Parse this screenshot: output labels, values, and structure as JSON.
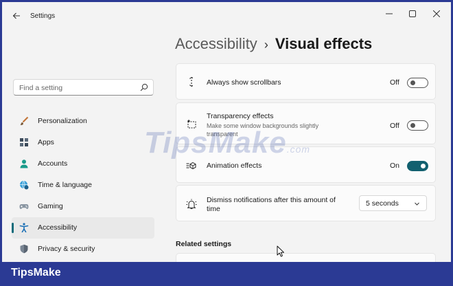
{
  "window": {
    "app_title": "Settings",
    "back_icon": "arrow-left-icon",
    "controls": [
      "minimize-icon",
      "maximize-icon",
      "close-icon"
    ]
  },
  "sidebar": {
    "search": {
      "placeholder": "Find a setting",
      "icon": "search-icon"
    },
    "items": [
      {
        "label": "Personalization",
        "icon": "brush-icon"
      },
      {
        "label": "Apps",
        "icon": "apps-icon"
      },
      {
        "label": "Accounts",
        "icon": "person-icon"
      },
      {
        "label": "Time & language",
        "icon": "globe-clock-icon"
      },
      {
        "label": "Gaming",
        "icon": "gamepad-icon"
      },
      {
        "label": "Accessibility",
        "icon": "accessibility-icon",
        "active": true
      },
      {
        "label": "Privacy & security",
        "icon": "shield-icon"
      }
    ]
  },
  "breadcrumb": {
    "parent": "Accessibility",
    "separator": "›",
    "current": "Visual effects"
  },
  "settings": [
    {
      "title": "Always show scrollbars",
      "state": "Off",
      "on": false,
      "icon": "scrollbar-icon"
    },
    {
      "title": "Transparency effects",
      "subtitle": "Make some window backgrounds slightly transparent",
      "state": "Off",
      "on": false,
      "icon": "transparency-icon"
    },
    {
      "title": "Animation effects",
      "state": "On",
      "on": true,
      "icon": "animation-icon"
    },
    {
      "title": "Dismiss notifications after this amount of time",
      "dropdown_value": "5 seconds",
      "icon": "notification-timer-icon"
    }
  ],
  "related": {
    "heading": "Related settings"
  },
  "watermark": {
    "main": "TipsMake",
    "suffix": ".com"
  },
  "footer": {
    "brand": "TipsMake"
  },
  "colors": {
    "accent": "#12606f",
    "frame": "#2b3a94"
  }
}
